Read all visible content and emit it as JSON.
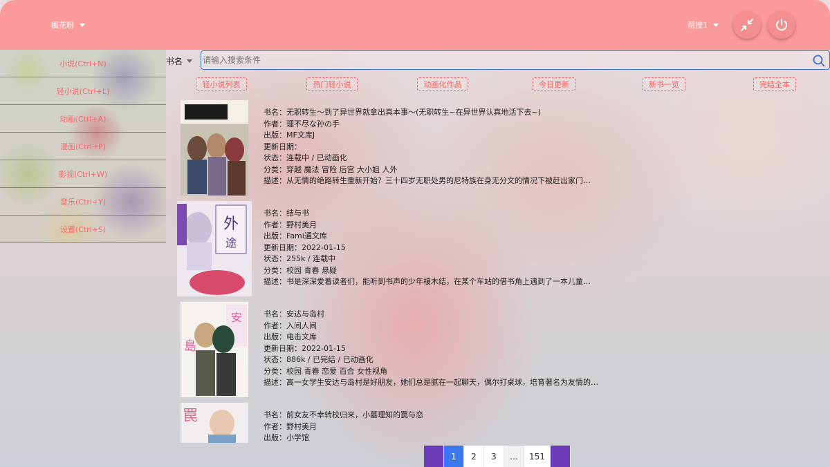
{
  "header": {
    "username": "楓花粉",
    "account": "帮搜1"
  },
  "sidebar": {
    "items": [
      {
        "label": "小说(Ctrl+N)"
      },
      {
        "label": "轻小说(Ctrl+L)"
      },
      {
        "label": "动画(Ctrl+A)"
      },
      {
        "label": "漫画(Ctrl+P)"
      },
      {
        "label": "影视(Ctrl+W)"
      },
      {
        "label": "音乐(Ctrl+Y)"
      },
      {
        "label": "设置(Ctrl+S)"
      }
    ]
  },
  "search": {
    "field_label": "书名",
    "placeholder": "请输入搜索条件"
  },
  "categories": [
    {
      "label": "轻小说列表"
    },
    {
      "label": "热门轻小说"
    },
    {
      "label": "动画化作品"
    },
    {
      "label": "今日更新"
    },
    {
      "label": "新书一览"
    },
    {
      "label": "完结全本"
    }
  ],
  "books": [
    {
      "title": "书名：无职转生～到了异世界就拿出真本事～(无职转生~在异世界认真地活下去~)",
      "author": "作者：理不尽な孙の手",
      "publisher": "出版：MF文库J",
      "updated": "更新日期：",
      "status": "状态：连载中 / 已动画化",
      "tags": "分类：穿越 魔法 冒险 后宫 大小姐 人外",
      "desc": "描述：从无情的绝路转生重新开始？三十四岁无职处男的尼特族在身无分文的情况下被赶出家门…"
    },
    {
      "title": "书名：结与书",
      "author": "作者：野村美月",
      "publisher": "出版：Fami通文库",
      "updated": "更新日期：2022-01-15",
      "status": "状态：255k / 连载中",
      "tags": "分类：校园 青春 悬疑",
      "desc": "描述：书是深深爱着读者们，能听到书声的少年榎木结，在某个车站的借书角上遇到了一本儿童…"
    },
    {
      "title": "书名：安达与岛村",
      "author": "作者：入间人间",
      "publisher": "出版：电击文库",
      "updated": "更新日期：2022-01-15",
      "status": "状态：886k / 已完结 / 已动画化",
      "tags": "分类：校园 青春 恋爱 百合 女性视角",
      "desc": "描述：高一女学生安达与岛村是好朋友，她们总是腻在一起聊天，偶尔打桌球，培育著名为友情的…"
    },
    {
      "title": "书名：前女友不幸转校归来，小墓理知的罠与恋",
      "author": "作者：野村美月",
      "publisher": "出版：小学馆"
    }
  ],
  "pagination": {
    "pages": [
      "1",
      "2",
      "3",
      "...",
      "151"
    ],
    "current": "1"
  },
  "colors": {
    "header": "#fb9a9a",
    "accent": "#f06060",
    "pager_active": "#3a78ee",
    "pager_edge": "#6a3ab8",
    "search_border": "#3a6fd8"
  }
}
